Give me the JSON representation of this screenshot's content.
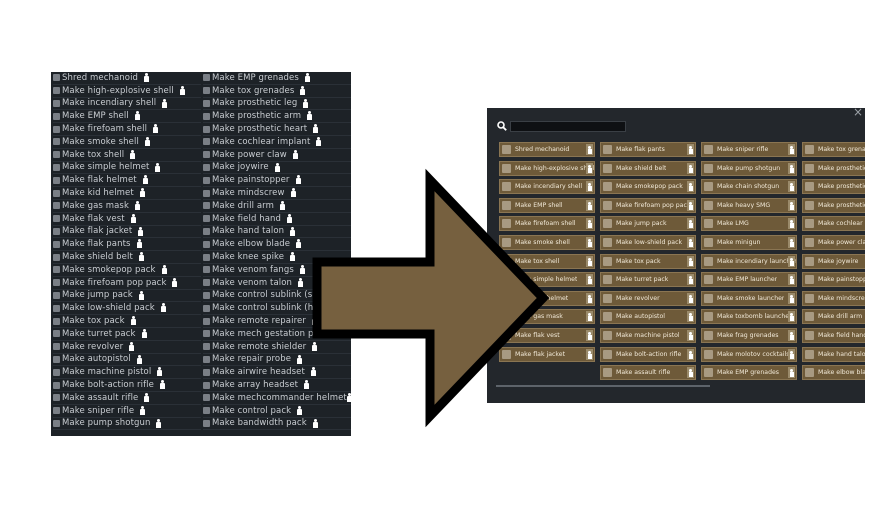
{
  "left_panel": {
    "column1": [
      {
        "label": "Shred mechanoid",
        "icon": "mech-icon"
      },
      {
        "label": "Make high-explosive shell",
        "icon": "shell-icon"
      },
      {
        "label": "Make incendiary shell",
        "icon": "shell-icon"
      },
      {
        "label": "Make EMP shell",
        "icon": "shell-icon"
      },
      {
        "label": "Make firefoam shell",
        "icon": "shell-icon"
      },
      {
        "label": "Make smoke shell",
        "icon": "shell-icon"
      },
      {
        "label": "Make tox shell",
        "icon": "shell-icon"
      },
      {
        "label": "Make simple helmet",
        "icon": "helmet-icon"
      },
      {
        "label": "Make flak helmet",
        "icon": "helmet-icon"
      },
      {
        "label": "Make kid helmet",
        "icon": "helmet-icon"
      },
      {
        "label": "Make gas mask",
        "icon": "mask-icon"
      },
      {
        "label": "Make flak vest",
        "icon": "vest-icon"
      },
      {
        "label": "Make flak jacket",
        "icon": "jacket-icon"
      },
      {
        "label": "Make flak pants",
        "icon": "pants-icon"
      },
      {
        "label": "Make shield belt",
        "icon": "belt-icon"
      },
      {
        "label": "Make smokepop pack",
        "icon": "pack-icon"
      },
      {
        "label": "Make firefoam pop pack",
        "icon": "pack-icon"
      },
      {
        "label": "Make jump pack",
        "icon": "pack-icon"
      },
      {
        "label": "Make low-shield pack",
        "icon": "pack-icon"
      },
      {
        "label": "Make tox pack",
        "icon": "pack-icon"
      },
      {
        "label": "Make turret pack",
        "icon": "pack-icon"
      },
      {
        "label": "Make revolver",
        "icon": "gun-icon"
      },
      {
        "label": "Make autopistol",
        "icon": "gun-icon"
      },
      {
        "label": "Make machine pistol",
        "icon": "gun-icon"
      },
      {
        "label": "Make bolt-action rifle",
        "icon": "rifle-icon"
      },
      {
        "label": "Make assault rifle",
        "icon": "rifle-icon"
      },
      {
        "label": "Make sniper rifle",
        "icon": "rifle-icon"
      },
      {
        "label": "Make pump shotgun",
        "icon": "shotgun-icon"
      }
    ],
    "column2": [
      {
        "label": "Make EMP grenades",
        "icon": "grenade-icon"
      },
      {
        "label": "Make tox grenades",
        "icon": "grenade-icon"
      },
      {
        "label": "Make prosthetic leg",
        "icon": "prosthetic-icon"
      },
      {
        "label": "Make prosthetic arm",
        "icon": "prosthetic-icon"
      },
      {
        "label": "Make prosthetic heart",
        "icon": "prosthetic-icon"
      },
      {
        "label": "Make cochlear implant",
        "icon": "implant-icon"
      },
      {
        "label": "Make power claw",
        "icon": "implant-icon"
      },
      {
        "label": "Make joywire",
        "icon": "implant-icon"
      },
      {
        "label": "Make painstopper",
        "icon": "implant-icon"
      },
      {
        "label": "Make mindscrew",
        "icon": "implant-icon"
      },
      {
        "label": "Make drill arm",
        "icon": "implant-icon"
      },
      {
        "label": "Make field hand",
        "icon": "implant-icon"
      },
      {
        "label": "Make hand talon",
        "icon": "implant-icon"
      },
      {
        "label": "Make elbow blade",
        "icon": "implant-icon"
      },
      {
        "label": "Make knee spike",
        "icon": "implant-icon"
      },
      {
        "label": "Make venom fangs",
        "icon": "implant-icon"
      },
      {
        "label": "Make venom talon",
        "icon": "implant-icon"
      },
      {
        "label": "Make control sublink (stand",
        "icon": "implant-icon"
      },
      {
        "label": "Make control sublink (high)",
        "icon": "implant-icon"
      },
      {
        "label": "Make remote repairer",
        "icon": "implant-icon"
      },
      {
        "label": "Make mech gestation proce",
        "icon": "implant-icon"
      },
      {
        "label": "Make remote shielder",
        "icon": "implant-icon"
      },
      {
        "label": "Make repair probe",
        "icon": "implant-icon"
      },
      {
        "label": "Make airwire headset",
        "icon": "headset-icon"
      },
      {
        "label": "Make array headset",
        "icon": "headset-icon"
      },
      {
        "label": "Make mechcommander helmet",
        "icon": "helmet-icon"
      },
      {
        "label": "Make control pack",
        "icon": "pack-icon"
      },
      {
        "label": "Make bandwidth pack",
        "icon": "pack-icon"
      }
    ]
  },
  "right_panel": {
    "close_label": "×",
    "search": {
      "value": "",
      "placeholder": ""
    },
    "columns": [
      [
        "Shred mechanoid",
        "Make high-explosive shell",
        "Make incendiary shell",
        "Make EMP shell",
        "Make firefoam shell",
        "Make smoke shell",
        "Make tox shell",
        "Make simple helmet",
        "Make flak helmet",
        "Make gas mask",
        "Make flak vest",
        "Make flak jacket"
      ],
      [
        "Make flak pants",
        "Make shield belt",
        "Make smokepop pack",
        "Make firefoam pop pack",
        "Make jump pack",
        "Make low-shield pack",
        "Make tox pack",
        "Make turret pack",
        "Make revolver",
        "Make autopistol",
        "Make machine pistol",
        "Make bolt-action rifle",
        "Make assault rifle"
      ],
      [
        "Make sniper rifle",
        "Make pump shotgun",
        "Make chain shotgun",
        "Make heavy SMG",
        "Make LMG",
        "Make minigun",
        "Make incendiary launcher",
        "Make EMP launcher",
        "Make smoke launcher",
        "Make toxbomb launcher",
        "Make frag grenades",
        "Make molotov cocktails",
        "Make EMP grenades"
      ],
      [
        "Make tox grenades",
        "Make prosthetic leg",
        "Make prosthetic arm",
        "Make prosthetic heart",
        "Make cochlear implant",
        "Make power claw",
        "Make joywire",
        "Make painstopper",
        "Make mindscrew",
        "Make drill arm",
        "Make field hand",
        "Make hand talon",
        "Make elbow blade"
      ]
    ]
  },
  "colors": {
    "left_bg": "#1d2227",
    "right_bg": "#23272c",
    "tile": "#6e5a39",
    "arrow_fill": "#76603f",
    "arrow_stroke": "#000000"
  }
}
